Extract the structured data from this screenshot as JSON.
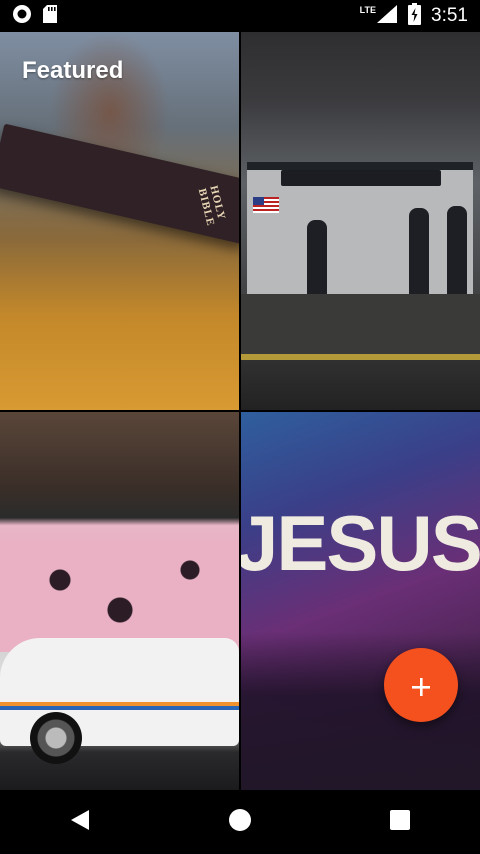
{
  "status_bar": {
    "time": "3:51",
    "network_label": "LTE",
    "icons": [
      "record-icon",
      "sd-card-icon",
      "signal-icon",
      "battery-icon"
    ]
  },
  "featured_label": "Featured",
  "tiles": [
    {
      "scene": "person holding holy bible",
      "embedded_text": "HOLY BIBLE"
    },
    {
      "scene": "subway platform with train"
    },
    {
      "scene": "pink cartoon mural with white ambulance"
    },
    {
      "scene": "worship concert crowd",
      "embedded_text": "JESUS"
    }
  ],
  "fab": {
    "icon": "plus-icon",
    "glyph": "+",
    "color": "#f4511e"
  },
  "nav_bar": {
    "icons": [
      "back-icon",
      "home-icon",
      "recents-icon"
    ]
  },
  "colors": {
    "accent": "#f4511e",
    "background": "#000000"
  }
}
